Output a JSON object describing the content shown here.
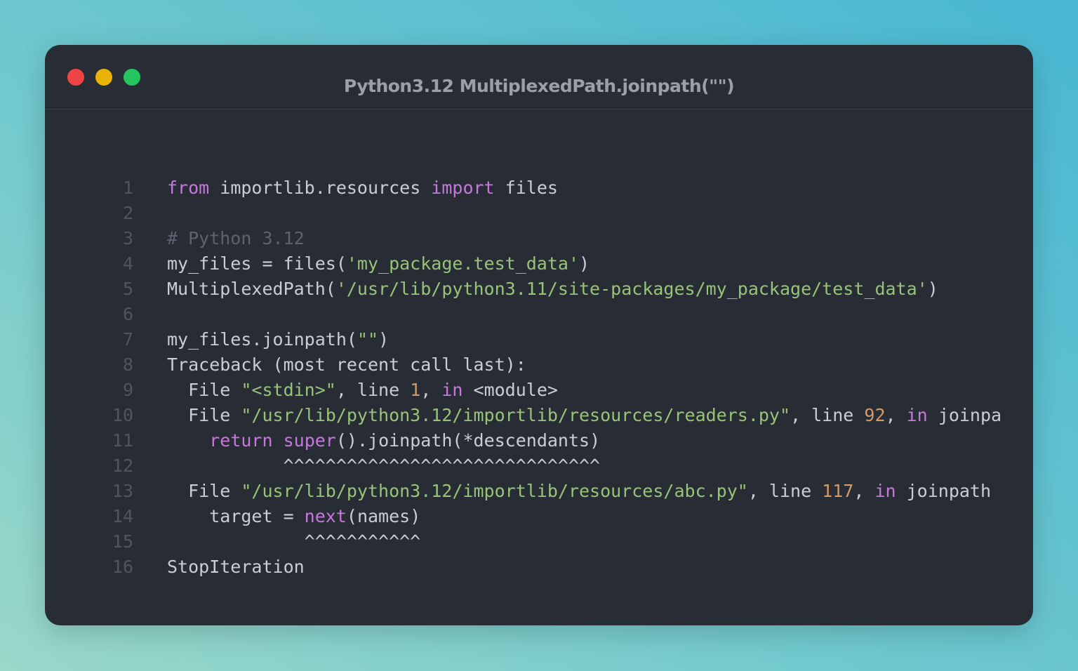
{
  "window": {
    "title": "Python3.12 MultiplexedPath.joinpath(\"\")",
    "controls": {
      "close_color": "#ef4444",
      "minimize_color": "#eab308",
      "maximize_color": "#22c55e"
    }
  },
  "colors": {
    "text": "#c9ced6",
    "keyword": "#c678dd",
    "string": "#98c379",
    "number": "#d19a66",
    "comment": "#5c6370",
    "line_number": "#4e5562"
  },
  "code": {
    "lines": [
      {
        "number": "1",
        "tokens": [
          [
            "keyword",
            "from"
          ],
          [
            "text",
            " importlib.resources "
          ],
          [
            "keyword",
            "import"
          ],
          [
            "text",
            " files"
          ]
        ]
      },
      {
        "number": "2",
        "tokens": []
      },
      {
        "number": "3",
        "tokens": [
          [
            "comment",
            "# Python 3.12"
          ]
        ]
      },
      {
        "number": "4",
        "tokens": [
          [
            "text",
            "my_files = files("
          ],
          [
            "string",
            "'my_package.test_data'"
          ],
          [
            "text",
            ")"
          ]
        ]
      },
      {
        "number": "5",
        "tokens": [
          [
            "text",
            "MultiplexedPath("
          ],
          [
            "string",
            "'/usr/lib/python3.11/site-packages/my_package/test_data'"
          ],
          [
            "text",
            ")"
          ]
        ]
      },
      {
        "number": "6",
        "tokens": []
      },
      {
        "number": "7",
        "tokens": [
          [
            "text",
            "my_files.joinpath("
          ],
          [
            "string",
            "\"\""
          ],
          [
            "text",
            ")"
          ]
        ]
      },
      {
        "number": "8",
        "tokens": [
          [
            "text",
            "Traceback (most recent call last):"
          ]
        ]
      },
      {
        "number": "9",
        "tokens": [
          [
            "text",
            "  File "
          ],
          [
            "string",
            "\"<stdin>\""
          ],
          [
            "text",
            ", line "
          ],
          [
            "number",
            "1"
          ],
          [
            "text",
            ", "
          ],
          [
            "keyword",
            "in"
          ],
          [
            "text",
            " <module>"
          ]
        ]
      },
      {
        "number": "10",
        "tokens": [
          [
            "text",
            "  File "
          ],
          [
            "string",
            "\"/usr/lib/python3.12/importlib/resources/readers.py\""
          ],
          [
            "text",
            ", line "
          ],
          [
            "number",
            "92"
          ],
          [
            "text",
            ", "
          ],
          [
            "keyword",
            "in"
          ],
          [
            "text",
            " joinpa"
          ]
        ]
      },
      {
        "number": "11",
        "tokens": [
          [
            "text",
            "    "
          ],
          [
            "keyword",
            "return"
          ],
          [
            "text",
            " "
          ],
          [
            "keyword",
            "super"
          ],
          [
            "text",
            "().joinpath(*descendants)"
          ]
        ]
      },
      {
        "number": "12",
        "tokens": [
          [
            "text",
            "           ^^^^^^^^^^^^^^^^^^^^^^^^^^^^^^"
          ]
        ]
      },
      {
        "number": "13",
        "tokens": [
          [
            "text",
            "  File "
          ],
          [
            "string",
            "\"/usr/lib/python3.12/importlib/resources/abc.py\""
          ],
          [
            "text",
            ", line "
          ],
          [
            "number",
            "117"
          ],
          [
            "text",
            ", "
          ],
          [
            "keyword",
            "in"
          ],
          [
            "text",
            " joinpath"
          ]
        ]
      },
      {
        "number": "14",
        "tokens": [
          [
            "text",
            "    target = "
          ],
          [
            "keyword",
            "next"
          ],
          [
            "text",
            "(names)"
          ]
        ]
      },
      {
        "number": "15",
        "tokens": [
          [
            "text",
            "             ^^^^^^^^^^^"
          ]
        ]
      },
      {
        "number": "16",
        "tokens": [
          [
            "text",
            "StopIteration"
          ]
        ]
      }
    ]
  }
}
